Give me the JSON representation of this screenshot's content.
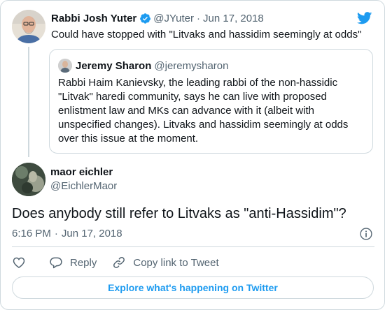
{
  "colors": {
    "accent": "#1d9bf0",
    "secondary_text": "#536471",
    "border": "#cfd9de"
  },
  "icons": {
    "brand": "twitter-bird-icon",
    "verified": "verified-badge-icon",
    "info": "info-icon",
    "like": "heart-icon",
    "reply": "reply-bubble-icon",
    "copy_link": "link-icon"
  },
  "parent_tweet": {
    "name": "Rabbi Josh Yuter",
    "handle": "@JYuter",
    "separator": "·",
    "date": "Jun 17, 2018",
    "text": "Could have stopped with \"Litvaks and hassidim seemingly at odds\"",
    "quoted": {
      "name": "Jeremy Sharon",
      "handle": "@jeremysharon",
      "text": "Rabbi Haim Kanievsky, the leading rabbi of the non-hassidic \"Litvak\" haredi community, says he can live with proposed enlistment law and MKs can advance with it (albeit with unspecified changes). Litvaks and hassidim seemingly at odds over this issue at the moment."
    }
  },
  "main_tweet": {
    "name": "maor eichler",
    "handle": "@EichlerMaor",
    "text": "Does anybody still refer to Litvaks as \"anti-Hassidim\"?",
    "time": "6:16 PM",
    "separator": "·",
    "date": "Jun 17, 2018"
  },
  "actions": {
    "reply_label": "Reply",
    "copy_link_label": "Copy link to Tweet"
  },
  "explore_label": "Explore what's happening on Twitter"
}
